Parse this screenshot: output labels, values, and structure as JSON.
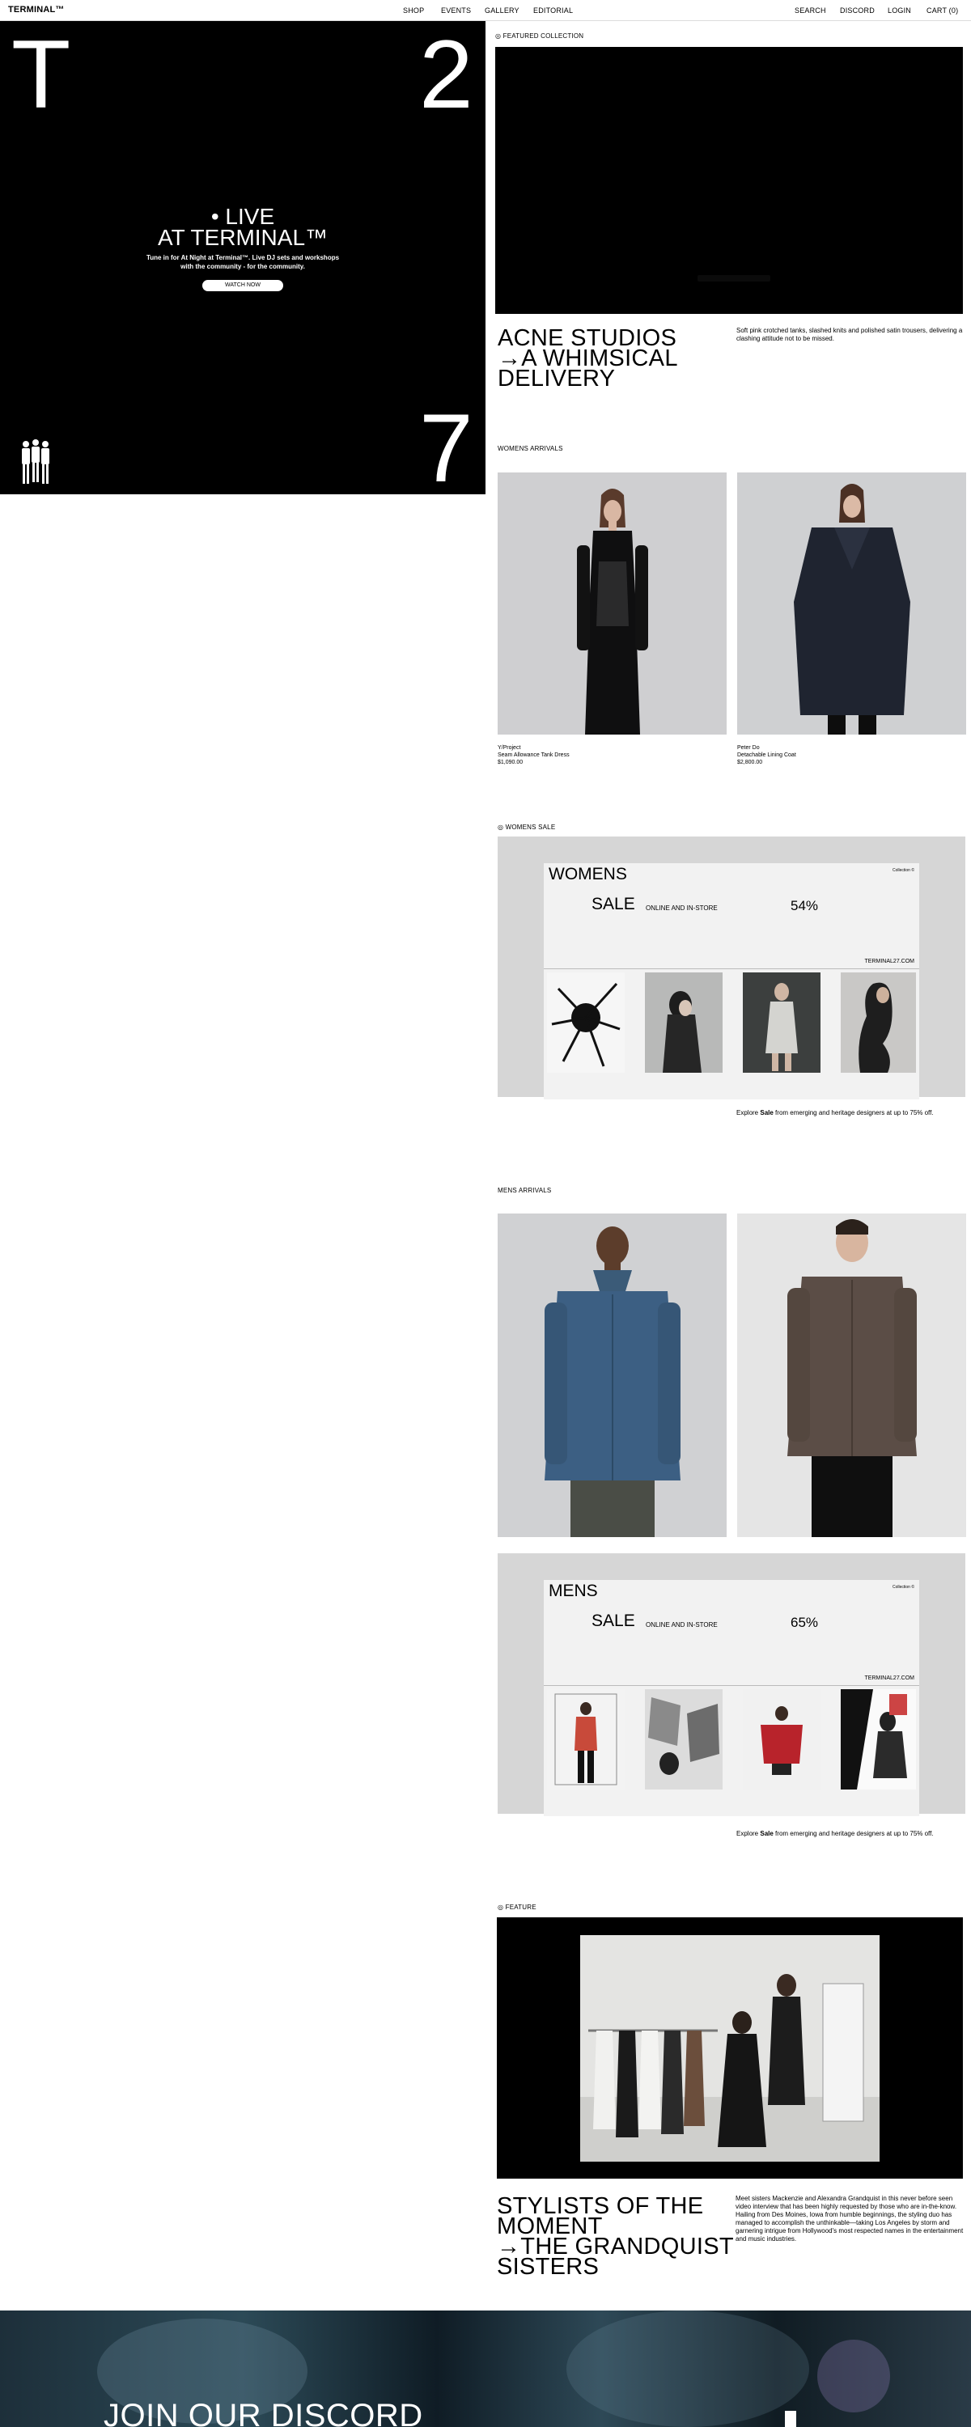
{
  "header": {
    "logo": "TERMINAL™",
    "nav_left": [
      "SHOP",
      "EVENTS",
      "GALLERY",
      "EDITORIAL"
    ],
    "nav_right": [
      "SEARCH",
      "DISCORD",
      "LOGIN",
      "CART (0)"
    ]
  },
  "hero": {
    "char_top_left": "T",
    "char_top_right": "2",
    "char_bottom_right": "7",
    "live_line1": "• LIVE",
    "live_line2": "AT TERMINAL™",
    "sub_line1": "Tune in for At Night at Terminal™. Live DJ sets and workshops",
    "sub_line2": "with the community - for the community.",
    "button": "WATCH NOW"
  },
  "featured": {
    "label": "◎ FEATURED COLLECTION",
    "title_lines": [
      "ACNE STUDIOS",
      "→A WHIMSICAL",
      "DELIVERY"
    ],
    "description": "Soft pink crotched tanks, slashed knits and polished satin trousers, delivering a clashing attitude not to be missed."
  },
  "womens_arrivals": {
    "label": "WOMENS ARRIVALS",
    "products": [
      {
        "brand": "Y/Project",
        "name": "Seam Allowance Tank Dress",
        "price": "$1,090.00"
      },
      {
        "brand": "Peter Do",
        "name": "Detachable Lining Coat",
        "price": "$2,800.00"
      }
    ]
  },
  "womens_sale": {
    "label": "◎ WOMENS SALE",
    "card_title": "WOMENS",
    "card_tag": "Collection ©",
    "sale": "SALE",
    "online": "ONLINE AND IN-STORE",
    "percent": "54%",
    "site": "TERMINAL27.COM",
    "explore_pre": "Explore ",
    "explore_bold": "Sale",
    "explore_post": " from emerging and heritage designers at up to 75% off."
  },
  "mens_arrivals": {
    "label": "MENS ARRIVALS"
  },
  "mens_sale": {
    "card_title": "MENS",
    "card_tag": "Collection ©",
    "sale": "SALE",
    "online": "ONLINE AND IN-STORE",
    "percent": "65%",
    "site": "TERMINAL27.COM",
    "explore_pre": "Explore ",
    "explore_bold": "Sale",
    "explore_post": " from emerging and heritage designers at up to 75% off."
  },
  "feature": {
    "label": "◎ FEATURE",
    "title_lines": [
      "STYLISTS OF THE",
      "MOMENT",
      "→THE GRANDQUIST",
      "SISTERS"
    ],
    "description": "Meet sisters Mackenzie and Alexandra Grandquist in this never before seen video interview that has been highly requested by those who are in-the-know. Hailing from Des Moines, Iowa from humble beginnings, the styling duo has managed to accomplish the unthinkable—taking Los Angeles by storm and garnering intrigue from Hollywood's most respected names in the entertainment and music industries."
  },
  "discord": {
    "title": "JOIN OUR DISCORD"
  },
  "colors": {
    "black": "#000000",
    "sale_bg": "#d6d6d6",
    "card_bg": "#f2f2f2",
    "photo_bg": "#cfd0d2"
  }
}
